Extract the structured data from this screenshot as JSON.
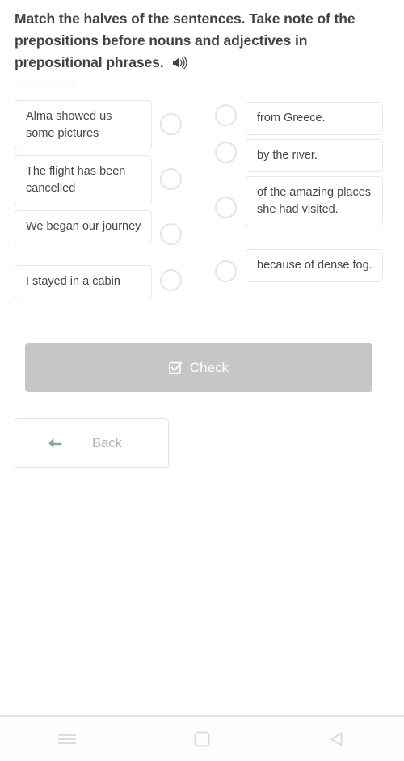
{
  "exercise": {
    "title": "Match the halves of the sentences. Take note of the prepositions before nouns and adjectives in prepositional phrases.",
    "audio_icon": "speaker-icon",
    "watermark": "30655591",
    "left_items": [
      {
        "text": "Alma showed us some pictures"
      },
      {
        "text": "The flight has been cancelled"
      },
      {
        "text": "We began our journey"
      },
      {
        "text": "I stayed in a cabin"
      }
    ],
    "right_items": [
      {
        "text": "from Greece."
      },
      {
        "text": "by the river."
      },
      {
        "text": "of the amazing places she had visited."
      },
      {
        "text": "because of dense fog."
      }
    ]
  },
  "actions": {
    "check_label": "Check",
    "check_icon": "checkbox-checked-icon",
    "check_bg_color": "#c6c6c6",
    "back_label": "Back",
    "back_icon": "arrow-left-icon",
    "back_text_color": "#a6b4b6"
  },
  "navbar": {
    "recents_icon": "menu-icon",
    "home_icon": "square-icon",
    "back_icon": "triangle-left-icon"
  }
}
